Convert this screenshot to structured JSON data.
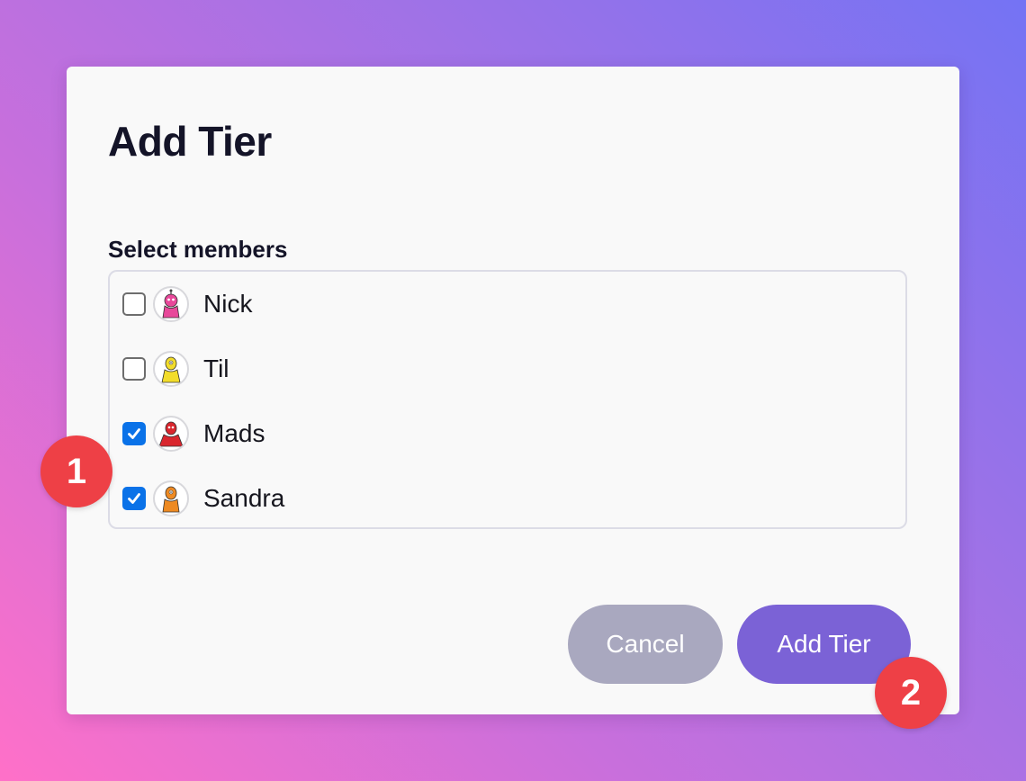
{
  "dialog": {
    "title": "Add Tier",
    "members_label": "Select members",
    "members": [
      {
        "name": "Nick",
        "checked": false,
        "avatar_icon": "pink-monster-avatar",
        "avatar_color": "#e8489a"
      },
      {
        "name": "Til",
        "checked": false,
        "avatar_icon": "yellow-monster-avatar",
        "avatar_color": "#f2dc2a"
      },
      {
        "name": "Mads",
        "checked": true,
        "avatar_icon": "red-monster-avatar",
        "avatar_color": "#d9262e"
      },
      {
        "name": "Sandra",
        "checked": true,
        "avatar_icon": "orange-monster-avatar",
        "avatar_color": "#ee8a22"
      }
    ],
    "buttons": {
      "cancel_label": "Cancel",
      "add_label": "Add Tier"
    }
  },
  "annotations": [
    {
      "label": "1"
    },
    {
      "label": "2"
    }
  ],
  "colors": {
    "checkbox_checked": "#0a72e8",
    "primary_button": "#7b62d6",
    "secondary_button": "#a9a8bf",
    "annotation_marker": "#ee4046"
  }
}
